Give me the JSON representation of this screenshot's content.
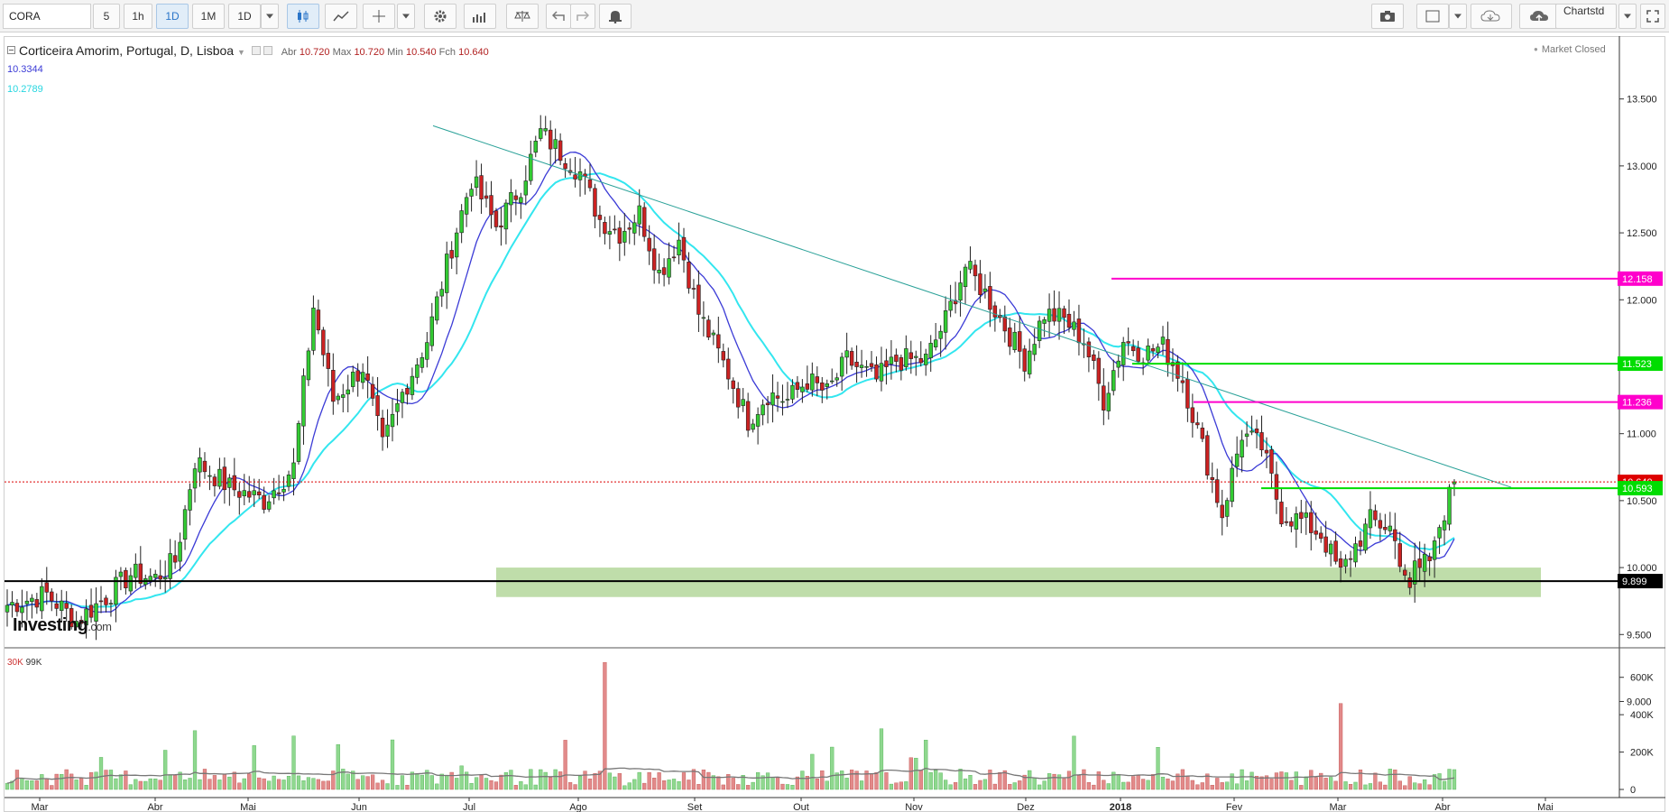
{
  "toolbar": {
    "symbol": "CORA",
    "intervals": [
      "5",
      "1h",
      "1D",
      "1M",
      "1D"
    ],
    "active_interval": "1D",
    "chartstd_label": "Chartstd"
  },
  "legend": {
    "title": "Corticeira Amorim, Portugal, D, Lisboa",
    "open_label": "Abr",
    "open": "10.720",
    "high_label": "Max",
    "high": "10.720",
    "low_label": "Min",
    "low": "10.540",
    "close_label": "Fch",
    "close": "10.640",
    "ma1": "10.3344",
    "ma2": "10.2789",
    "market_status": "Market Closed"
  },
  "volume_legend": {
    "v1": "30K",
    "v2": "99K"
  },
  "logo": {
    "name": "Investing",
    "suffix": ".com"
  },
  "colors": {
    "up": "#33cc33",
    "down": "#cc2222",
    "ma_fast": "#3b3bd6",
    "ma_slow": "#33e6ef",
    "trendline": "#2aa198",
    "magenta": "#ff00cc",
    "green_level": "#00dd00",
    "support_zone": "#a9d18e",
    "vol_up": "#8fd88f",
    "vol_down": "#e28a8a",
    "vol_ma": "#777777"
  },
  "chart_data": {
    "type": "candlestick",
    "symbol": "CORA",
    "timeframe": "D",
    "price_axis": {
      "min": 8.7,
      "max": 13.7,
      "ticks": [
        "13.500",
        "13.000",
        "12.500",
        "12.000",
        "11.500",
        "11.000",
        "10.500",
        "10.000",
        "9.500",
        "9.000"
      ]
    },
    "volume_axis": {
      "min": 0,
      "max": 700000,
      "ticks": [
        "600K",
        "400K",
        "200K",
        "0"
      ]
    },
    "x_labels": [
      "Mar",
      "Abr",
      "Mai",
      "Jun",
      "Jul",
      "Ago",
      "Set",
      "Out",
      "Nov",
      "Dez",
      "2018",
      "Fev",
      "Mar",
      "Abr",
      "Mai"
    ],
    "candle_count": 285,
    "anchor_closes": [
      [
        0,
        9.72
      ],
      [
        8,
        9.8
      ],
      [
        14,
        9.6
      ],
      [
        20,
        9.78
      ],
      [
        25,
        9.95
      ],
      [
        30,
        9.92
      ],
      [
        34,
        10.05
      ],
      [
        38,
        10.8
      ],
      [
        45,
        10.6
      ],
      [
        52,
        10.5
      ],
      [
        58,
        10.75
      ],
      [
        62,
        11.95
      ],
      [
        66,
        11.25
      ],
      [
        72,
        11.5
      ],
      [
        76,
        10.9
      ],
      [
        80,
        11.3
      ],
      [
        85,
        11.7
      ],
      [
        90,
        12.4
      ],
      [
        94,
        12.9
      ],
      [
        99,
        12.55
      ],
      [
        104,
        12.85
      ],
      [
        108,
        13.25
      ],
      [
        112,
        13.1
      ],
      [
        116,
        12.95
      ],
      [
        120,
        12.6
      ],
      [
        124,
        12.5
      ],
      [
        128,
        12.65
      ],
      [
        132,
        12.2
      ],
      [
        136,
        12.45
      ],
      [
        140,
        11.9
      ],
      [
        146,
        11.45
      ],
      [
        150,
        11.1
      ],
      [
        154,
        11.3
      ],
      [
        158,
        11.25
      ],
      [
        162,
        11.4
      ],
      [
        166,
        11.3
      ],
      [
        170,
        11.55
      ],
      [
        176,
        11.4
      ],
      [
        180,
        11.55
      ],
      [
        186,
        11.55
      ],
      [
        190,
        11.85
      ],
      [
        194,
        12.25
      ],
      [
        198,
        12.05
      ],
      [
        202,
        11.8
      ],
      [
        206,
        11.55
      ],
      [
        210,
        11.9
      ],
      [
        214,
        11.85
      ],
      [
        218,
        11.7
      ],
      [
        222,
        11.25
      ],
      [
        226,
        11.7
      ],
      [
        230,
        11.6
      ],
      [
        234,
        11.65
      ],
      [
        238,
        11.4
      ],
      [
        242,
        10.9
      ],
      [
        246,
        10.4
      ],
      [
        250,
        11.0
      ],
      [
        254,
        10.9
      ],
      [
        258,
        10.4
      ],
      [
        262,
        10.35
      ],
      [
        266,
        10.25
      ],
      [
        270,
        9.95
      ],
      [
        272,
        10.1
      ],
      [
        276,
        10.35
      ],
      [
        280,
        10.3
      ],
      [
        284,
        9.85
      ]
    ],
    "extra_closes_after": [
      10.05,
      10.0,
      10.1,
      10.05,
      10.2,
      10.3,
      10.35,
      10.6,
      10.64
    ],
    "levels": [
      {
        "value": 12.158,
        "label": "12.158",
        "color": "#ff00cc"
      },
      {
        "value": 11.523,
        "label": "11.523",
        "color": "#00dd00"
      },
      {
        "value": 11.236,
        "label": "11.236",
        "color": "#ff00cc"
      },
      {
        "value": 10.64,
        "label": "10.640",
        "color": "#dd0000"
      },
      {
        "value": 10.593,
        "label": "10.593",
        "color": "#00dd00"
      },
      {
        "value": 9.899,
        "label": "9.899",
        "color": "#000000"
      }
    ],
    "trendline": {
      "from": [
        13.3,
        0.26
      ],
      "to": [
        10.6,
        0.91
      ]
    },
    "support_zone": {
      "top": 10.0,
      "bottom": 9.78
    },
    "last_price": 10.64
  }
}
